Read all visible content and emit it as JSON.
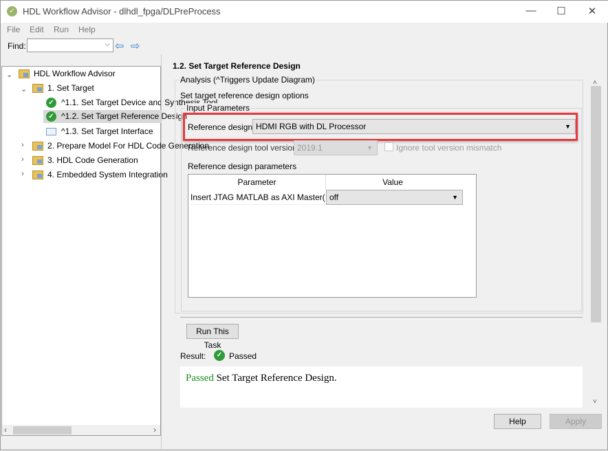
{
  "window": {
    "title": "HDL Workflow Advisor - dlhdl_fpga/DLPreProcess",
    "minimize": "—",
    "maximize": "☐",
    "close": "✕"
  },
  "menu": [
    "File",
    "Edit",
    "Run",
    "Help"
  ],
  "toolbar": {
    "find_label": "Find:",
    "find_value": "",
    "back_icon": "arrow-left-icon",
    "forward_icon": "arrow-right-icon"
  },
  "tree": {
    "root": "HDL Workflow Advisor",
    "items": [
      {
        "label": "1. Set Target"
      },
      {
        "label": "^1.1. Set Target Device and Synthesis Tool",
        "status": "passed"
      },
      {
        "label": "^1.2. Set Target Reference Design",
        "status": "passed",
        "selected": true
      },
      {
        "label": "^1.3. Set Target Interface",
        "status": "not-run"
      },
      {
        "label": "2. Prepare Model For HDL Code Generation"
      },
      {
        "label": "3. HDL Code Generation"
      },
      {
        "label": "4. Embedded System Integration"
      }
    ]
  },
  "main": {
    "title": "1.2. Set Target Reference Design",
    "analysis_legend": "Analysis (^Triggers Update Diagram)",
    "description": "Set target reference design options",
    "input_legend": "Input Parameters",
    "ref_design_label": "Reference design:",
    "ref_design_value": "HDMI RGB with DL Processor",
    "tool_version_label": "Reference design tool version:",
    "tool_version_value": "2019.1",
    "ignore_mismatch_label": "Ignore tool version mismatch",
    "ignore_mismatch_checked": false,
    "params_label": "Reference design parameters",
    "table": {
      "headers": [
        "Parameter",
        "Value"
      ],
      "rows": [
        [
          "Insert JTAG MATLAB as AXI Master(H...",
          "off"
        ]
      ]
    },
    "run_button": "Run This Task",
    "result_label": "Result:",
    "result_value": "Passed",
    "report_status": "Passed",
    "report_text": " Set Target Reference Design.",
    "highlight_color": "#e8393f"
  },
  "buttons": {
    "help": "Help",
    "apply": "Apply"
  }
}
